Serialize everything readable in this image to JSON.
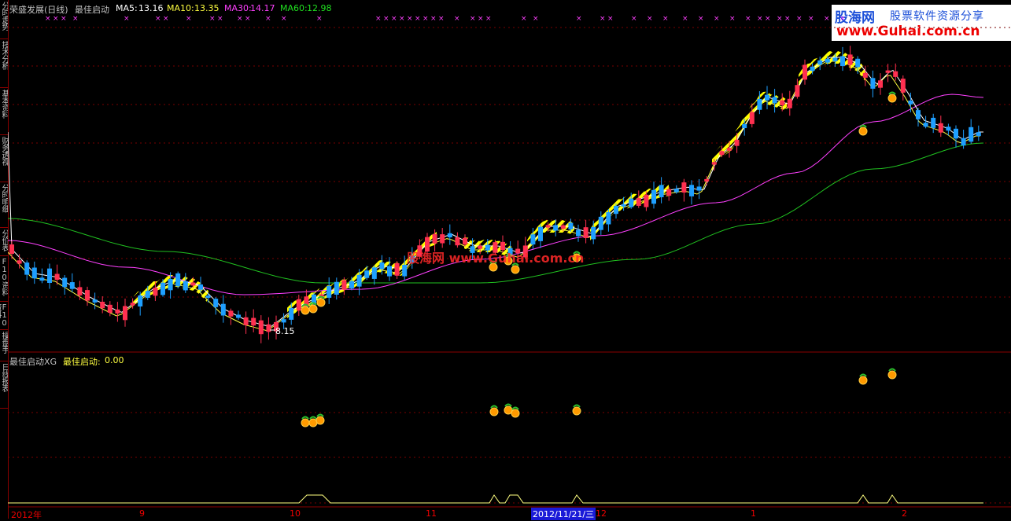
{
  "header": {
    "stock_name": "荣盛发展(日线)",
    "indicator_name": "最佳启动",
    "ma5_label": "MA5:",
    "ma5_value": "13.16",
    "ma10_label": "MA10:",
    "ma10_value": "13.35",
    "ma30_label": "MA30:",
    "ma30_value": "14.17",
    "ma60_label": "MA60:",
    "ma60_value": "12.98"
  },
  "sidebar": {
    "tabs": [
      "分时走势",
      "技术分析",
      "基本资料",
      "财务透视",
      "分时明细",
      "分价表",
      "F10资料",
      "F10资料F10",
      "操盘手",
      "日线报表"
    ]
  },
  "logo": {
    "brand": "股海网",
    "slogan": "股票软件资源分享",
    "url": "www.Guhai.com.cn"
  },
  "watermark": {
    "text": "股海网 www.Guhai.com.cn"
  },
  "main_chart": {
    "low_marker": "8.15"
  },
  "sub_chart": {
    "title": "最佳启动XG",
    "value_label": "最佳启动:",
    "value": "0.00"
  },
  "date_axis": {
    "labels": [
      "2012年",
      "9",
      "10",
      "11",
      "12",
      "1",
      "2"
    ],
    "cursor_label": "2012/11/21/三"
  },
  "colors": {
    "up_candle": "#ff3050",
    "down_candle": "#1e9fff",
    "ma5": "#ffffff",
    "ma10": "#ffff40",
    "ma30": "#ff40ff",
    "ma60": "#20c020",
    "highlight_band": "#ffff00",
    "signal_line": "#ffff80",
    "grid_border": "#8b0000"
  },
  "chart_data": {
    "type": "candlestick",
    "title": "荣盛发展(日线)",
    "indicator": "最佳启动",
    "moving_averages": {
      "MA5": 13.16,
      "MA10": 13.35,
      "MA30": 14.17,
      "MA60": 12.98
    },
    "period_low": 8.15,
    "x_labels": [
      "2012年",
      "9",
      "10",
      "11",
      "12",
      "1",
      "2"
    ],
    "signal_series": {
      "name": "最佳启动",
      "value": 0.0
    }
  }
}
